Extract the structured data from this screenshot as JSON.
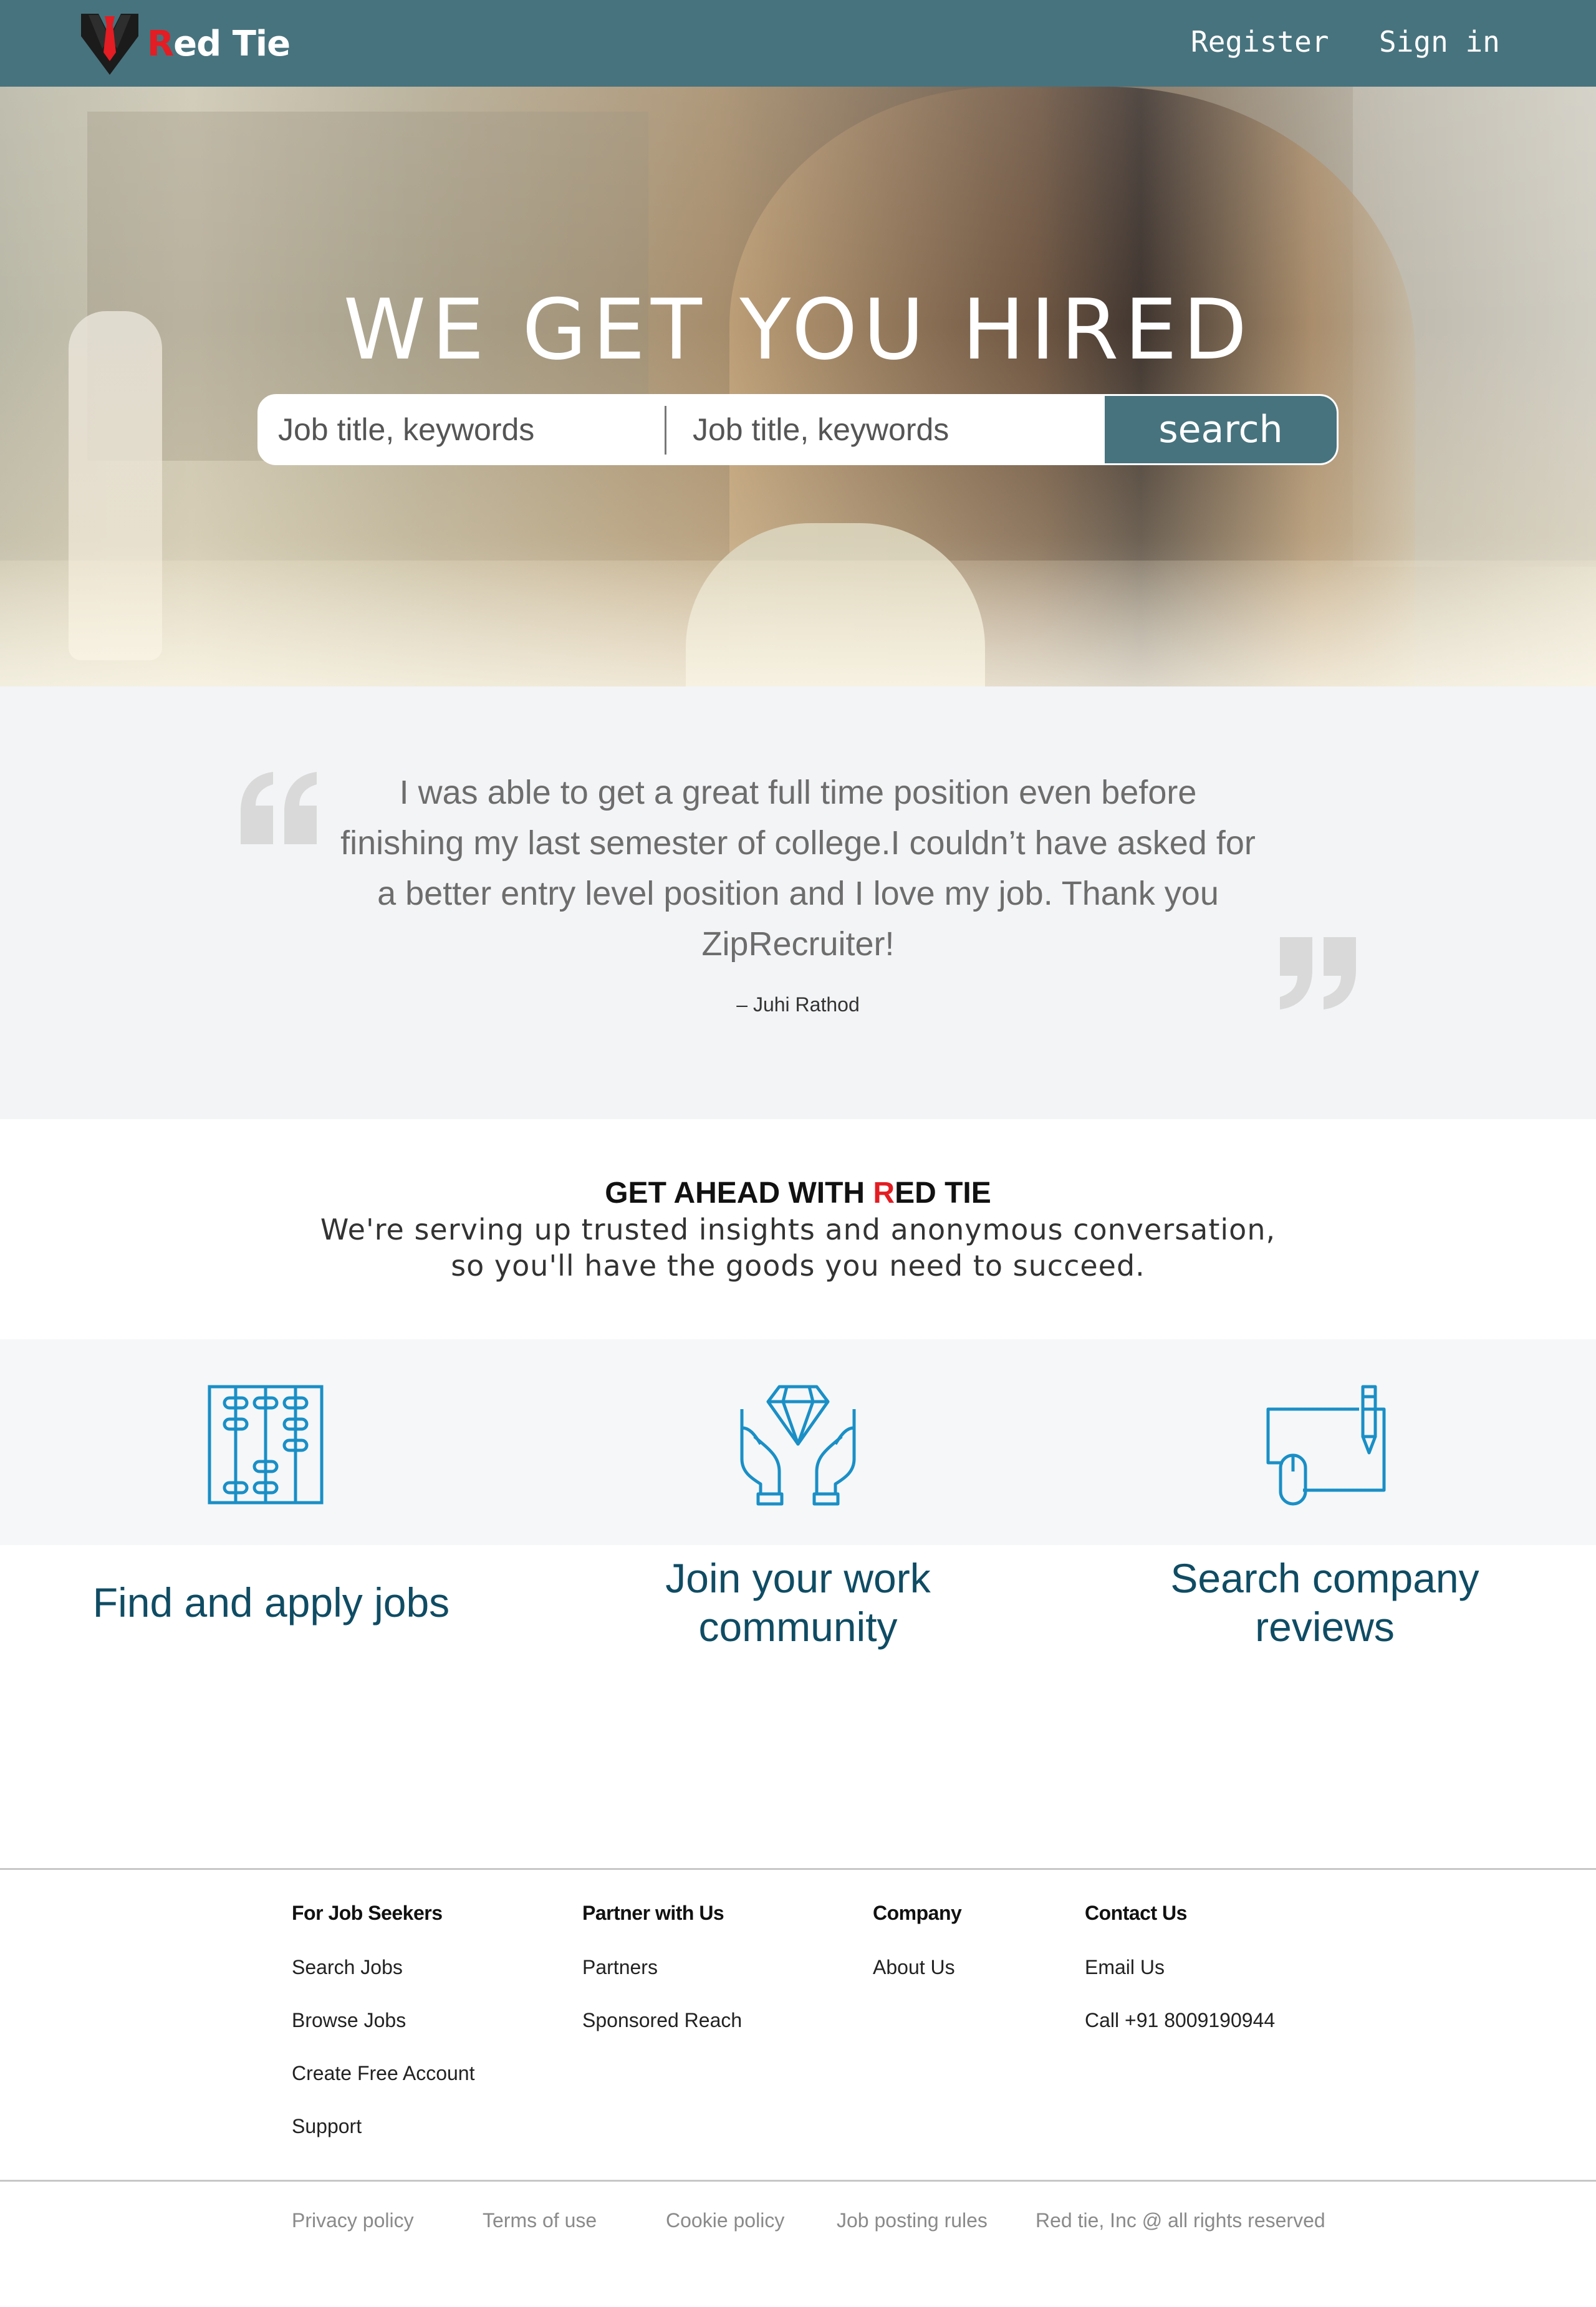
{
  "nav": {
    "brand_first": "R",
    "brand_rest": "ed Tie",
    "register": "Register",
    "sign_in": "Sign in"
  },
  "hero": {
    "title": "WE GET YOU HIRED",
    "search": {
      "field1_placeholder": "Job title, keywords",
      "field2_placeholder": "Job title, keywords",
      "button": "search"
    }
  },
  "testimonial": {
    "quote": "I was able to get a great full time position even before finishing my last semester of college.I couldn’t have asked for a better entry level position and I love my job. Thank you ZipRecruiter!",
    "author": "– Juhi Rathod"
  },
  "get_ahead": {
    "title_prefix": "GET AHEAD WITH ",
    "title_red": "R",
    "title_suffix": "ED TIE",
    "subtitle": "We're serving up trusted insights and anonymous conversation, so you'll have the goods you need to succeed."
  },
  "features": [
    {
      "icon": "abacus-icon",
      "label": "Find and apply jobs"
    },
    {
      "icon": "diamond-hands-icon",
      "label": "Join your work community"
    },
    {
      "icon": "drawing-board-icon",
      "label": "Search company reviews"
    }
  ],
  "footer": {
    "columns": [
      {
        "heading": "For Job Seekers",
        "links": [
          "Search Jobs",
          "Browse Jobs",
          "Create Free Account",
          "Support"
        ]
      },
      {
        "heading": "Partner with Us",
        "links": [
          "Partners",
          "Sponsored Reach"
        ]
      },
      {
        "heading": "Company",
        "links": [
          "About Us"
        ]
      },
      {
        "heading": "Contact Us",
        "links": [
          "Email Us",
          "Call +91 8009190944"
        ]
      }
    ],
    "legal": {
      "privacy": "Privacy policy",
      "terms": "Terms of use",
      "cookie": "Cookie policy",
      "rules": "Job posting rules",
      "copyright": "Red tie, Inc @ all rights reserved"
    }
  },
  "colors": {
    "primary": "#47737e",
    "accent_red": "#e31d23",
    "feature_blue": "#1a8fc6",
    "feature_text": "#0f4c64"
  }
}
